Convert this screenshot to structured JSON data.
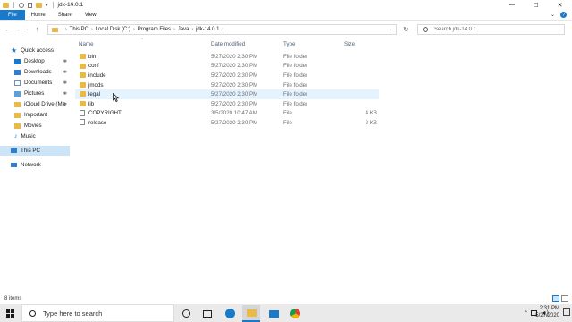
{
  "window": {
    "title": "jdk-14.0.1",
    "controls": {
      "minimize": "—",
      "maximize": "☐",
      "close": "✕"
    }
  },
  "ribbon": {
    "tabs": [
      "File",
      "Home",
      "Share",
      "View"
    ],
    "expand": "⌄",
    "help": "?"
  },
  "nav_buttons": {
    "back": "←",
    "forward": "→",
    "recent": "⌄",
    "up": "↑"
  },
  "address": {
    "crumbs": [
      "This PC",
      "Local Disk (C:)",
      "Program Files",
      "Java",
      "jdk-14.0.1"
    ],
    "separator": "›",
    "dropdown": "⌄"
  },
  "refresh": "↻",
  "search": {
    "placeholder": "Search jdk-14.0.1"
  },
  "navpane": {
    "quick_access": "Quick access",
    "items": [
      {
        "label": "Desktop",
        "pinned": true,
        "icon": "desktop-icon"
      },
      {
        "label": "Downloads",
        "pinned": true,
        "icon": "downloads-icon"
      },
      {
        "label": "Documents",
        "pinned": true,
        "icon": "documents-icon"
      },
      {
        "label": "Pictures",
        "pinned": true,
        "icon": "pictures-icon"
      },
      {
        "label": "iCloud Drive (Ma",
        "pinned": true,
        "icon": "icloud-icon"
      },
      {
        "label": "Important",
        "pinned": false,
        "icon": "folder-icon"
      },
      {
        "label": "Movies",
        "pinned": false,
        "icon": "folder-icon"
      },
      {
        "label": "Music",
        "pinned": false,
        "icon": "music-icon"
      }
    ],
    "this_pc": "This PC",
    "network": "Network",
    "pin_glyph": "📌"
  },
  "columns": {
    "name": "Name",
    "date": "Date modified",
    "type": "Type",
    "size": "Size"
  },
  "files": [
    {
      "name": "bin",
      "date": "5/27/2020 2:30 PM",
      "type": "File folder",
      "size": "",
      "kind": "folder"
    },
    {
      "name": "conf",
      "date": "5/27/2020 2:30 PM",
      "type": "File folder",
      "size": "",
      "kind": "folder"
    },
    {
      "name": "include",
      "date": "5/27/2020 2:30 PM",
      "type": "File folder",
      "size": "",
      "kind": "folder"
    },
    {
      "name": "jmods",
      "date": "5/27/2020 2:30 PM",
      "type": "File folder",
      "size": "",
      "kind": "folder"
    },
    {
      "name": "legal",
      "date": "5/27/2020 2:30 PM",
      "type": "File folder",
      "size": "",
      "kind": "folder"
    },
    {
      "name": "lib",
      "date": "5/27/2020 2:30 PM",
      "type": "File folder",
      "size": "",
      "kind": "folder"
    },
    {
      "name": "COPYRIGHT",
      "date": "3/5/2020 10:47 AM",
      "type": "File",
      "size": "4 KB",
      "kind": "file"
    },
    {
      "name": "release",
      "date": "5/27/2020 2:30 PM",
      "type": "File",
      "size": "2 KB",
      "kind": "file"
    }
  ],
  "status": {
    "items": "8 items"
  },
  "taskbar": {
    "search_placeholder": "Type here to search",
    "time": "2:31 PM",
    "date": "5/27/2020",
    "tray_caret": "^"
  },
  "colors": {
    "accent": "#1979ca",
    "folder": "#e9b949",
    "selection": "#cce4f7",
    "hover": "#e5f3ff",
    "header_text": "#4c607a"
  }
}
